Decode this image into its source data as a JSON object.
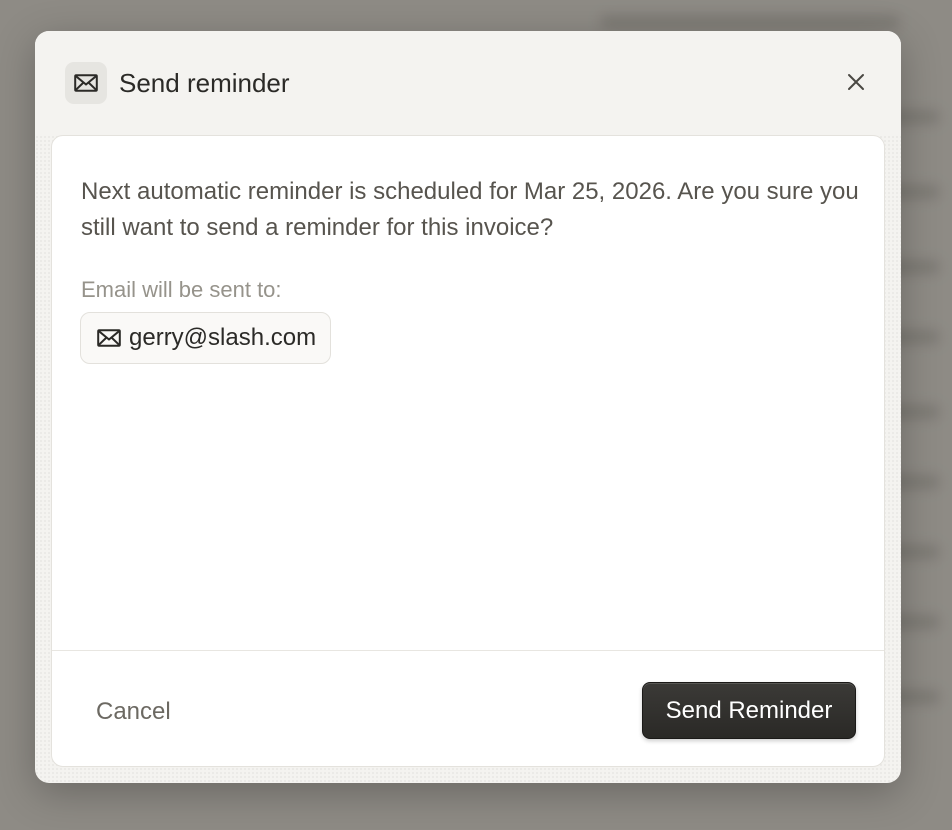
{
  "dialog": {
    "title": "Send reminder",
    "icon": "mail-icon",
    "close_icon": "close-icon"
  },
  "body": {
    "message": "Next automatic reminder is scheduled for Mar 25, 2026. Are you sure you still want to send a reminder for this invoice?",
    "recipients_label": "Email will be sent to:",
    "recipient_email": "gerry@slash.com",
    "recipient_icon": "mail-icon"
  },
  "footer": {
    "cancel_label": "Cancel",
    "submit_label": "Send Reminder"
  },
  "colors": {
    "overlay": "#8e8b85",
    "primary_button": "#2f2e2b",
    "text_primary": "#2b2a27",
    "text_secondary": "#57544e",
    "text_muted": "#96938b"
  }
}
